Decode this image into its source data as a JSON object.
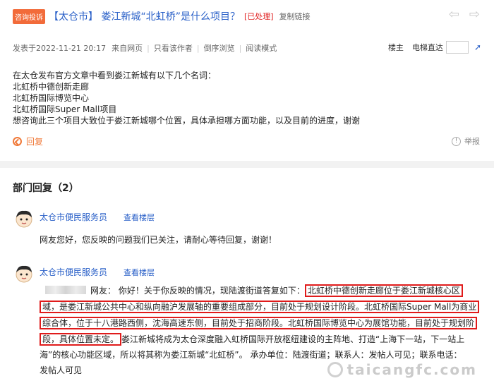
{
  "thread": {
    "badge": "咨询投诉",
    "title": "【太仓市】 娄江新城“北虹桥”是什么项目？",
    "status": "[已处理]",
    "copy_link": "复制链接"
  },
  "meta": {
    "posted": "发表于2022-11-21 20:17",
    "source": "来自网页",
    "author_only": "只看该作者",
    "reverse": "倒序浏览",
    "read_mode": "阅读模式",
    "owner": "楼主",
    "jump_floor": "电梯直达"
  },
  "post": {
    "lines": [
      "在太仓发布官方文章中看到娄江新城有以下几个名词：",
      "北虹桥中德创新走廊",
      "北虹桥国际博览中心",
      "北虹桥国际Super Mall项目",
      "想咨询此三个项目大致位于娄江新城哪个位置，具体承担哪方面功能，以及目前的进度，谢谢"
    ],
    "reply_label": "回复",
    "report_label": "举报"
  },
  "replies": {
    "section_title": "部门回复（2）",
    "items": [
      {
        "name": "太仓市便民服务员",
        "floor_label": "查看楼层",
        "text": "网友您好，您反映的问题我们已关注，请耐心等待回复，谢谢！"
      },
      {
        "name": "太仓市便民服务员",
        "floor_label": "查看楼层",
        "l1_pre": "网友：  你好！关于你反映的情况，现陆渡街道答复如下：",
        "l1_hl": "北虹桥中德创新走廊位于娄江新城核心区",
        "l2_hl": "域，是娄江新城公共中心和纵向融沪发展轴的重要组成部分，目前处于规划设计阶段。北虹桥国际Super Mall为商业",
        "l3_hl": "综合体，位于十八港路西侧，沈海高速东侧，目前处于招商阶段。北虹桥国际博览中心为展馆功能，目前处于规划阶",
        "l4_hl": "段，具体位置未定。",
        "l4_rest": "娄江新城将成为太仓深度融入虹桥国际开放枢纽建设的主阵地、打造“上海下一站，下一站上",
        "l5": "海”的核心功能区域，所以将其称为娄江新城“北虹桥”。 承办单位：陆渡街道；联系人：发帖人可见；联系电话：",
        "l6": "发帖人可见"
      }
    ]
  },
  "watermark": "taicangfc.com"
}
